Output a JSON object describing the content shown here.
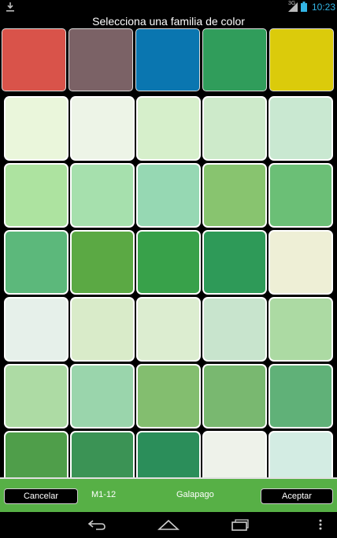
{
  "status": {
    "clock": "10:23",
    "network": "3G"
  },
  "dialog": {
    "title": "Selecciona una familia de color",
    "families": [
      "#d9534a",
      "#7b6266",
      "#0a76b0",
      "#309d5b",
      "#dbcb0b"
    ],
    "grid": [
      [
        "#eaf6db",
        "#edf4e7",
        "#d6efcb",
        "#cdeaca",
        "#c9e8d1"
      ],
      [
        "#ade3a0",
        "#a6e0ad",
        "#96d8b3",
        "#88c46f",
        "#6bbf76"
      ],
      [
        "#5cb87b",
        "#5ba944",
        "#38a14a",
        "#2e9a58",
        "#eeefd6"
      ],
      [
        "#e6f0ea",
        "#d9ebc9",
        "#dcedd0",
        "#c8e4cd",
        "#acdaa3"
      ],
      [
        "#addba4",
        "#9ad5ac",
        "#83be6f",
        "#79b870",
        "#60b178"
      ],
      [
        "#4f9e4a",
        "#3b9355",
        "#2b8e5a",
        "#eef2ea",
        "#d3ece3"
      ]
    ],
    "selected": {
      "code": "M1-12",
      "name": "Galapago"
    },
    "cancel_label": "Cancelar",
    "accept_label": "Aceptar"
  }
}
